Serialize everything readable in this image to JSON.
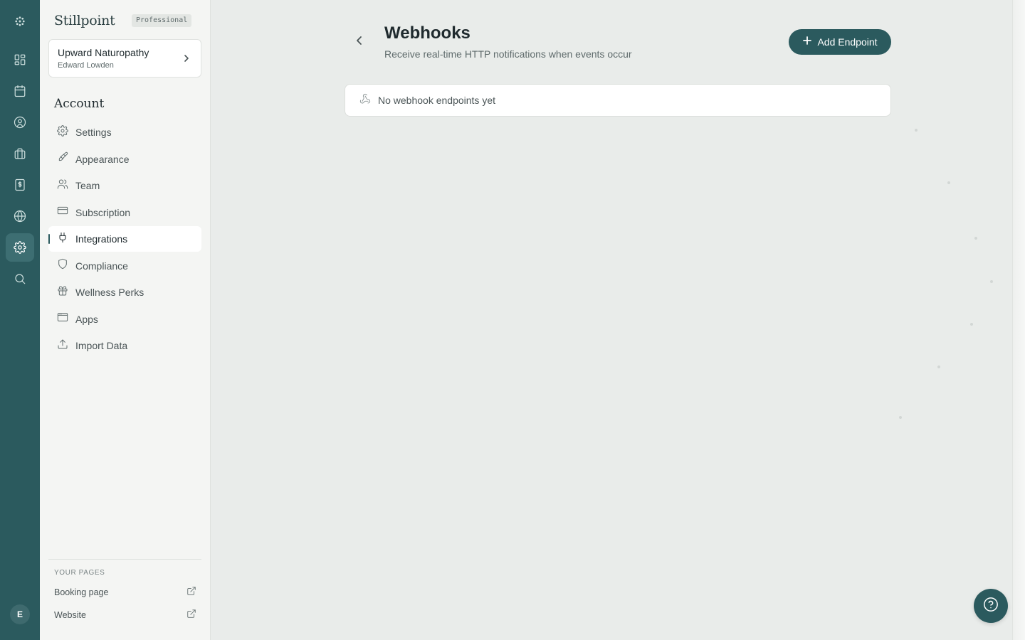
{
  "colors": {
    "accent": "#2b5a5e",
    "rail_background": "#2b5a5e",
    "sidebar_background": "#f4f5f3",
    "main_background": "#e9ecea"
  },
  "rail": {
    "items": [
      {
        "icon": "logo-mark-icon"
      },
      {
        "icon": "dashboard-icon"
      },
      {
        "icon": "calendar-icon"
      },
      {
        "icon": "clients-icon"
      },
      {
        "icon": "briefcase-icon"
      },
      {
        "icon": "billing-icon"
      },
      {
        "icon": "globe-icon"
      },
      {
        "icon": "settings-icon",
        "active": true
      },
      {
        "icon": "search-icon"
      }
    ],
    "avatar_initial": "E"
  },
  "sidebar": {
    "brand": "Stillpoint",
    "plan_badge": "Professional",
    "practice": {
      "name": "Upward Naturopathy",
      "owner": "Edward Lowden",
      "icon": "chevron-right-icon"
    },
    "section_heading": "Account",
    "nav": [
      {
        "label": "Settings",
        "icon": "gear-icon"
      },
      {
        "label": "Appearance",
        "icon": "paintbrush-icon"
      },
      {
        "label": "Team",
        "icon": "users-icon"
      },
      {
        "label": "Subscription",
        "icon": "credit-card-icon"
      },
      {
        "label": "Integrations",
        "icon": "plug-icon",
        "active": true
      },
      {
        "label": "Compliance",
        "icon": "shield-icon"
      },
      {
        "label": "Wellness Perks",
        "icon": "gift-icon"
      },
      {
        "label": "Apps",
        "icon": "app-window-icon"
      },
      {
        "label": "Import Data",
        "icon": "upload-icon"
      }
    ],
    "your_pages": {
      "heading": "YOUR PAGES",
      "links": [
        {
          "label": "Booking page",
          "icon": "external-link-icon"
        },
        {
          "label": "Website",
          "icon": "external-link-icon"
        }
      ]
    }
  },
  "main": {
    "title": "Webhooks",
    "subtitle": "Receive real-time HTTP notifications when events occur",
    "back_icon": "chevron-left-icon",
    "add_button": {
      "label": "Add Endpoint",
      "icon": "plus-icon"
    },
    "empty_state": {
      "text": "No webhook endpoints yet",
      "icon": "webhook-icon"
    },
    "help_icon": "help-circle-icon"
  }
}
